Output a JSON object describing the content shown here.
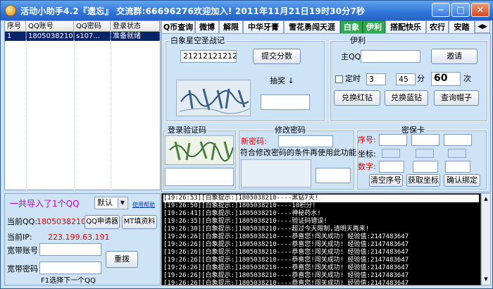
{
  "window": {
    "title": "活动小助手4.2『遗忘』 交流群:66696276欢迎加入!     2011年11月21日19时30分7秒",
    "minimize": "─",
    "maximize": "□",
    "close": "✕"
  },
  "account_table": {
    "columns": [
      "序号",
      "QQ账号",
      "QQ密码",
      "登录状态"
    ],
    "rows": [
      {
        "index": "1",
        "qq": "1805038210",
        "pwd": "s107...",
        "status": "准备就绪"
      }
    ]
  },
  "tabs": [
    "Q币查询",
    "微博",
    "解限",
    "中华牙膏",
    "雪花勇闯天涯",
    "白象",
    "伊利",
    "搭配快乐",
    "农行",
    "安踏"
  ],
  "tab_arrows": "◀▶",
  "baixiang": {
    "group_title": "白象星空圣战记",
    "input_value": "21212121212121",
    "submit_label": "提交分数",
    "lottery_label": "抽奖 ↓"
  },
  "yili": {
    "group_title": "伊利",
    "qq_label": "主QQ:",
    "invite_label": "邀请",
    "timer_label": "定时",
    "timer_hour": "3",
    "timer_min": "45",
    "min_unit": "分",
    "count": "60",
    "count_unit": "次",
    "exchange_red": "兑换红钻",
    "exchange_blue": "兑换蓝钻",
    "query_hat": "查询帽子"
  },
  "login_captcha": {
    "group_title": "登录验证码"
  },
  "change_pwd": {
    "group_title": "修改密码",
    "new_pwd_label": "新密码:",
    "hint": "符合修改密码的条件再使用此功能"
  },
  "secret_card": {
    "group_title": "密保卡",
    "serial_label": "序号:",
    "coord_label": "坐标:",
    "digit_label": "数字:",
    "clear_label": "清空序号",
    "get_coord_label": "获取坐标",
    "confirm_label": "确认绑定"
  },
  "bottom_left": {
    "imported": "一共导入了1个QQ",
    "mode_value": "默认",
    "help": "使用帮助",
    "current_qq_label": "当前QQ:",
    "current_qq": "1805038210",
    "qq_apply": "QQ申请器",
    "mt_fill": "MT填资料",
    "current_ip_label": "当前IP:",
    "current_ip": "223.199.63.191",
    "bb_account_label": "宽带账号",
    "bb_pwd_label": "宽带密码",
    "redial_label": "重拨",
    "f1_hint": "F1选择下一个QQ"
  },
  "log": [
    "[19:26:53][白象提示:]1805038210----黑钻7天!",
    "[19:26:50][白象提示:]1805038210----10积分!",
    "[19:26:41][白象提示:]1805038210----神秘药水!",
    "[19:26:35][白象提示:]1805038210----验证码错误!",
    "[19:26:30][白象提示:]1805038210----超过今天限制,请明天再来!",
    "[19:26:26][白象提示:]1805038210----恭喜您!闯关成功! 经验值:2147483647",
    "[19:26:26][白象提示:]1805038210----恭喜您!闯关成功! 经验值:2147483647",
    "[19:26:26][白象提示:]1805038210----恭喜您!闯关成功! 经验值:2147483647",
    "[19:26:26][白象提示:]1805038210----恭喜您!闯关成功! 经验值:2147483647",
    "[19:26:26][白象提示:]1805038210----恭喜您!闯关成功! 经验值:2147483647",
    "[19:26:26][白象提示:]1805038210----恭喜您!闯关成功! 经验值:2147483647",
    "[19:26:26][白象提示:]1805038210----恭喜您!闯关成功! 经验值:2147483647"
  ]
}
